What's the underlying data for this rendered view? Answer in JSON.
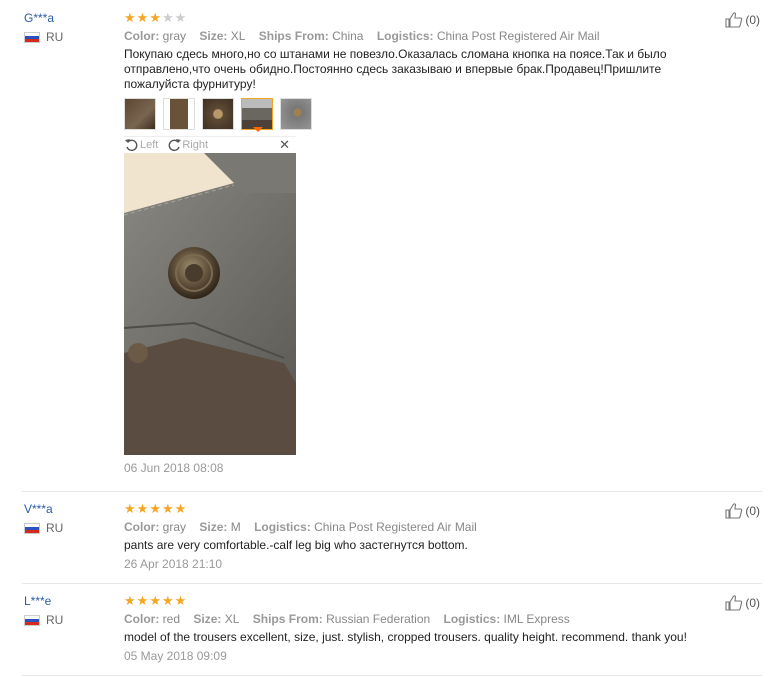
{
  "labels": {
    "color": "Color:",
    "size": "Size:",
    "ships": "Ships From:",
    "logistics": "Logistics:",
    "left": "Left",
    "right": "Right"
  },
  "colors": {
    "accent": "#f5a623",
    "link": "#2a5ba8",
    "active_arrow": "#ff6600"
  },
  "reviews": [
    {
      "user": "G***a",
      "country": "RU",
      "rating": 3,
      "rating_max": 5,
      "color": "gray",
      "size": "XL",
      "ships_from": "China",
      "logistics": "China Post Registered Air Mail",
      "text": "Покупаю сдесь много,но со штанами не повезло.Оказалась сломана кнопка на поясе.Так и было отправлено,что очень обидно.Постоянно сдесь заказываю и впервые брак.Продавец!Пришлите пожалуйста фурнитуру!",
      "date": "06 Jun 2018 08:08",
      "likes": "(0)",
      "thumb_count": 5,
      "active_thumb": 4
    },
    {
      "user": "V***a",
      "country": "RU",
      "rating": 5,
      "rating_max": 5,
      "color": "gray",
      "size": "M",
      "logistics": "China Post Registered Air Mail",
      "text": "pants are very comfortable.-calf leg big who застегнутся bottom.",
      "date": "26 Apr 2018 21:10",
      "likes": "(0)"
    },
    {
      "user": "L***e",
      "country": "RU",
      "rating": 5,
      "rating_max": 5,
      "color": "red",
      "size": "XL",
      "ships_from": "Russian Federation",
      "logistics": "IML Express",
      "text": "model of the trousers excellent, size, just. stylish, cropped trousers. quality height. recommend. thank you!",
      "date": "05 May 2018 09:09",
      "likes": "(0)"
    }
  ]
}
